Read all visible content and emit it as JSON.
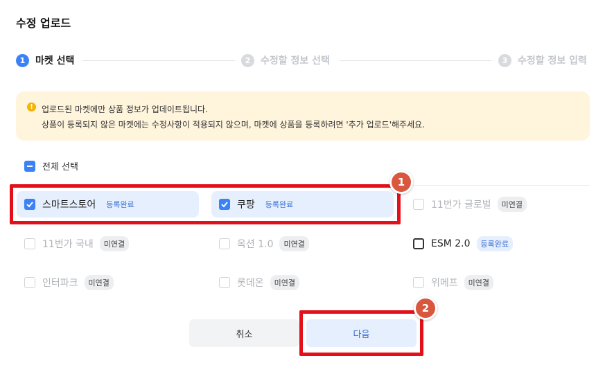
{
  "title": "수정 업로드",
  "stepper": {
    "steps": [
      {
        "num": "1",
        "label": "마켓 선택"
      },
      {
        "num": "2",
        "label": "수정할 정보 선택"
      },
      {
        "num": "3",
        "label": "수정할 정보 입력"
      }
    ]
  },
  "notice": {
    "icon": "warning-icon",
    "line1": "업로드된 마켓에만 상품 정보가 업데이트됩니다.",
    "line2": "상품이 등록되지 않은 마켓에는 수정사항이 적용되지 않으며, 마켓에 상품을 등록하려면 '추가 업로드'해주세요."
  },
  "select_all": {
    "label": "전체 선택"
  },
  "markets": [
    {
      "name": "스마트스토어",
      "status": "등록완료",
      "checked": true
    },
    {
      "name": "쿠팡",
      "status": "등록완료",
      "checked": true
    },
    {
      "name": "11번가 글로벌",
      "status": "미연결",
      "checked": false
    },
    {
      "name": "11번가 국내",
      "status": "미연결",
      "checked": false
    },
    {
      "name": "옥션 1.0",
      "status": "미연결",
      "checked": false
    },
    {
      "name": "ESM 2.0",
      "status": "등록완료",
      "checked": false
    },
    {
      "name": "인터파크",
      "status": "미연결",
      "checked": false
    },
    {
      "name": "롯데온",
      "status": "미연결",
      "checked": false
    },
    {
      "name": "위메프",
      "status": "미연결",
      "checked": false
    }
  ],
  "buttons": {
    "cancel": "취소",
    "next": "다음"
  },
  "annotations": {
    "badge1": "1",
    "badge2": "2"
  },
  "colors": {
    "accent": "#3b82f6",
    "annotation_red": "#e3101a",
    "notice_bg": "#fff4dc"
  }
}
